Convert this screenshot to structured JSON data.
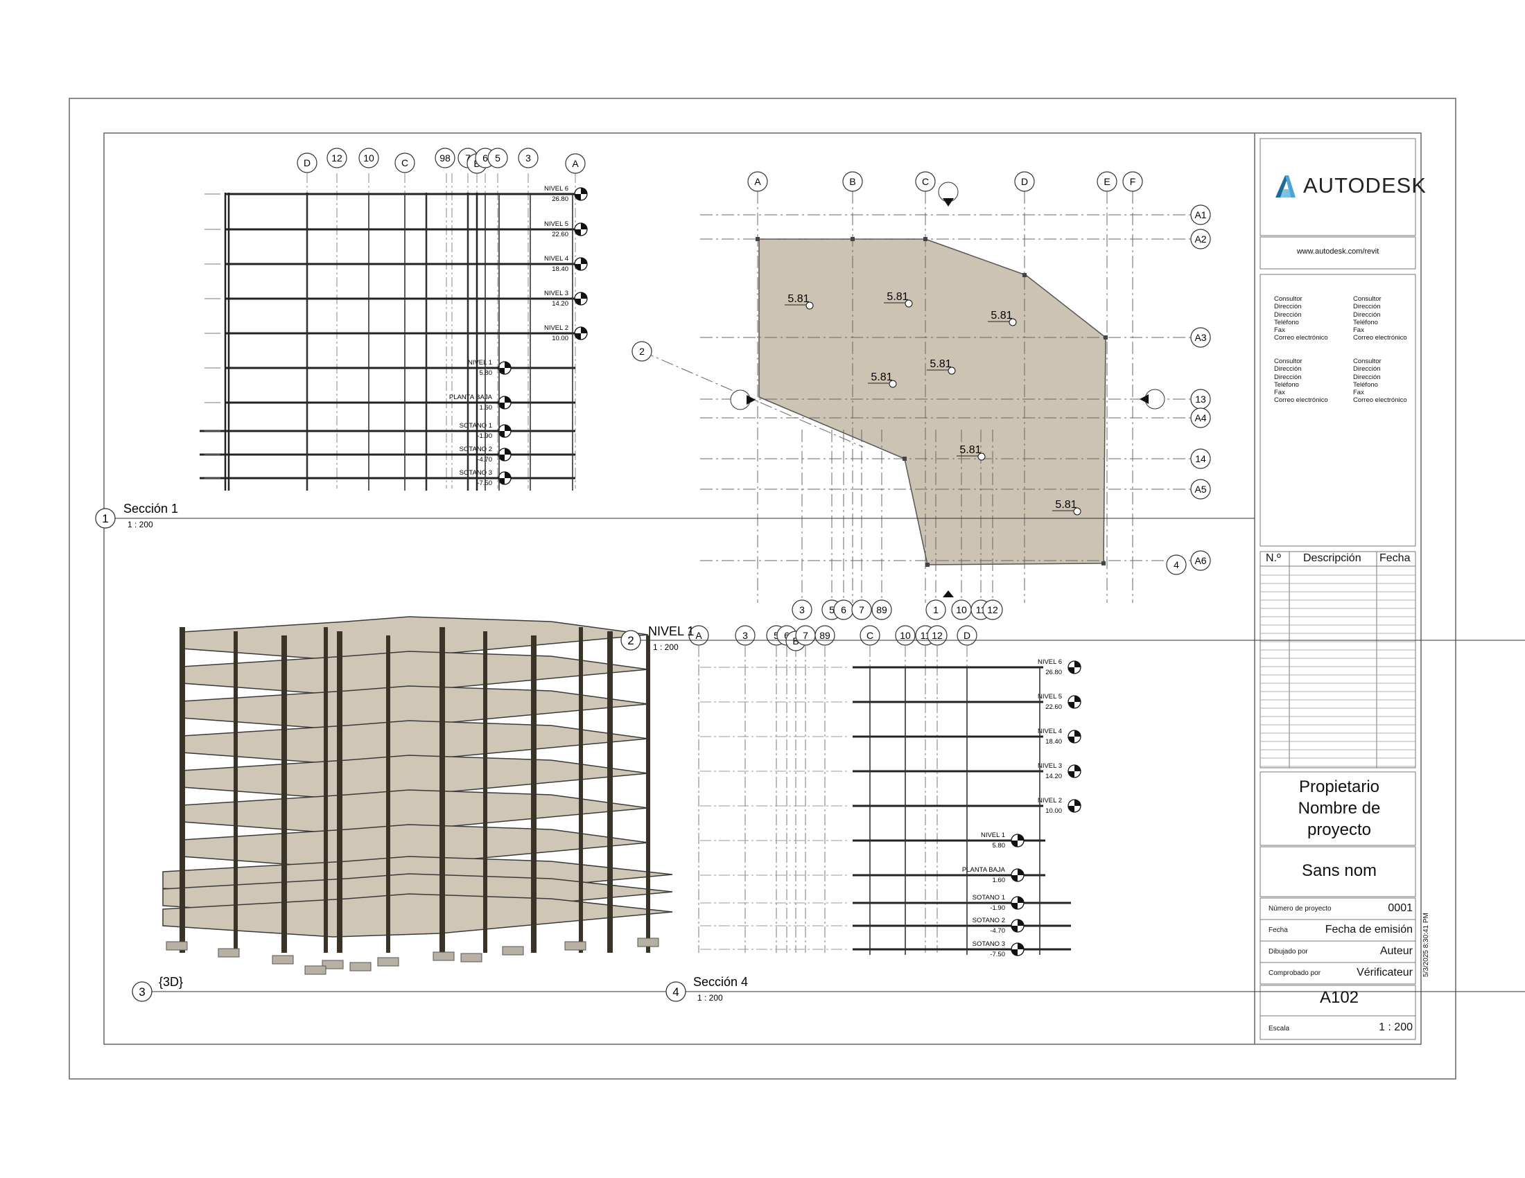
{
  "titleblock": {
    "brand": "AUTODESK",
    "url": "www.autodesk.com/revit",
    "consultants": [
      [
        "Consultor",
        "Dirección",
        "Dirección",
        "Teléfono",
        "Fax",
        "Correo electrónico"
      ],
      [
        "Consultor",
        "Dirección",
        "Dirección",
        "Teléfono",
        "Fax",
        "Correo electrónico"
      ],
      [
        "Consultor",
        "Dirección",
        "Dirección",
        "Teléfono",
        "Fax",
        "Correo electrónico"
      ],
      [
        "Consultor",
        "Dirección",
        "Dirección",
        "Teléfono",
        "Fax",
        "Correo electrónico"
      ]
    ],
    "revision_headers": [
      "N.º",
      "Descripción",
      "Fecha"
    ],
    "owner_line1": "Propietario",
    "owner_line2": "Nombre de",
    "owner_line3": "proyecto",
    "sheet_name": "Sans nom",
    "fields": [
      {
        "label": "Número de proyecto",
        "value": "0001"
      },
      {
        "label": "Fecha",
        "value": "Fecha de emisión"
      },
      {
        "label": "Dibujado por",
        "value": "Auteur"
      },
      {
        "label": "Comprobado por",
        "value": "Vérificateur"
      }
    ],
    "sheet_number": "A102",
    "scale_label": "Escala",
    "scale_value": "1 : 200",
    "timestamp": "5/3/2025 8:30:41 PM"
  },
  "views": {
    "section1": {
      "number": "1",
      "title": "Sección 1",
      "scale": "1 : 200"
    },
    "plan": {
      "number": "2",
      "title": "NIVEL 1",
      "scale": "1 : 200"
    },
    "view3d": {
      "number": "3",
      "title": "{3D}"
    },
    "section4": {
      "number": "4",
      "title": "Sección 4",
      "scale": "1 : 200"
    }
  },
  "section1_grids": [
    "D",
    "12",
    "10",
    "C",
    "98",
    "7",
    "B",
    "6",
    "5",
    "3",
    "A"
  ],
  "levels": [
    {
      "name": "NIVEL 6",
      "elev": "26.80"
    },
    {
      "name": "NIVEL 5",
      "elev": "22.60"
    },
    {
      "name": "NIVEL 4",
      "elev": "18.40"
    },
    {
      "name": "NIVEL 3",
      "elev": "14.20"
    },
    {
      "name": "NIVEL 2",
      "elev": "10.00"
    },
    {
      "name": "NIVEL 1",
      "elev": "5.80"
    },
    {
      "name": "PLANTA BAJA",
      "elev": "1.60"
    },
    {
      "name": "SOTANO 1",
      "elev": "-1.90"
    },
    {
      "name": "SOTANO 2",
      "elev": "-4.70"
    },
    {
      "name": "SOTANO 3",
      "elev": "-7.50"
    }
  ],
  "plan_top_grids": [
    "A",
    "B",
    "C",
    "D",
    "E",
    "F"
  ],
  "plan_right_grids": [
    "A1",
    "A2",
    "A3",
    "13",
    "A4",
    "14",
    "A5",
    "A6"
  ],
  "plan_bottom_grids": [
    "3",
    "5",
    "6",
    "7",
    "89",
    "1",
    "10",
    "11",
    "12"
  ],
  "plan_left_grids": [
    "2",
    "4"
  ],
  "spot_elevations": [
    "5.81",
    "5.81",
    "5.81",
    "5.81",
    "5.81",
    "5.81",
    "5.81"
  ],
  "section4_grids": [
    "A",
    "3",
    "5",
    "6",
    "B",
    "7",
    "89",
    "C",
    "10",
    "11",
    "12",
    "D"
  ]
}
